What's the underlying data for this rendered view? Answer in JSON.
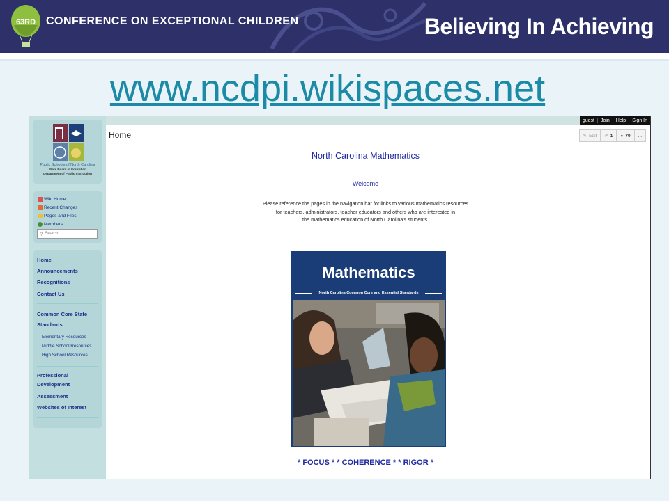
{
  "banner": {
    "badge": "63RD",
    "conference_title": "CONFERENCE ON EXCEPTIONAL CHILDREN",
    "slogan": "Believing In Achieving",
    "colors": {
      "background": "#2e3169",
      "text": "#ffffff",
      "balloon": "#8fbf3f"
    }
  },
  "url_text": "www.ncdpi.wikispaces.net",
  "wiki": {
    "topbar": [
      "guest",
      "Join",
      "Help",
      "Sign In"
    ],
    "logo": {
      "line1": "Public Schools of North Carolina",
      "line2": "State Board of Education",
      "line3": "Department of Public Instruction"
    },
    "tools": [
      {
        "label": "Wiki Home",
        "icon": "house-icon"
      },
      {
        "label": "Recent Changes",
        "icon": "calendar-icon"
      },
      {
        "label": "Pages and Files",
        "icon": "files-icon"
      },
      {
        "label": "Members",
        "icon": "members-icon"
      }
    ],
    "search_placeholder": "Search",
    "nav": {
      "group1": [
        "Home",
        "Announcements",
        "Recognitions",
        "Contact Us"
      ],
      "ccss_line1": "Common Core State",
      "ccss_line2": "Standards",
      "ccss_sub": [
        "Elementary Resources",
        "Middle School Resources",
        "High School Resources"
      ],
      "pd_line1": "Professional",
      "pd_line2": "Development",
      "group3": [
        "Assessment",
        "Websites of Interest"
      ]
    },
    "page_title": "Home",
    "page_tools": {
      "edit": "Edit",
      "count1": "1",
      "count2": "70",
      "more": "..."
    },
    "main_title": "North Carolina Mathematics",
    "welcome": "Welcome",
    "paragraph": [
      "Please reference the pages in the navigation bar for links to various mathematics resources",
      "for teachers, administrators, teacher educators and others who are interested in",
      "the mathematics education of North Carolina's students."
    ],
    "cover": {
      "title": "Mathematics",
      "subtitle": "North Carolina Common Core and Essential Standards"
    },
    "tagline": "* FOCUS * * COHERENCE * * RIGOR *"
  }
}
